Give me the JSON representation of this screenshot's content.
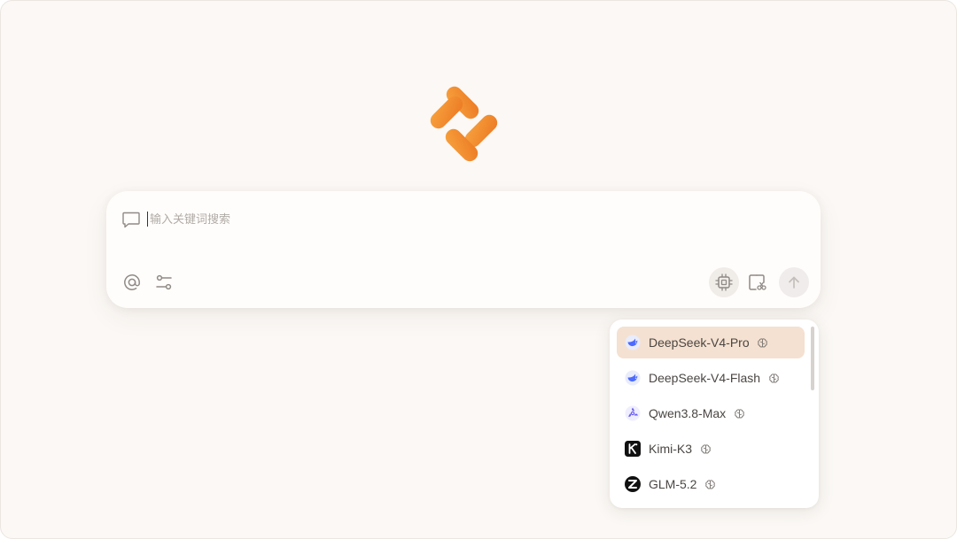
{
  "colors": {
    "background": "#fbf8f5",
    "brand_orange": "#f08a2a",
    "selected_item": "#f5e1d1",
    "text": "#4a4643",
    "placeholder": "#b0aba6"
  },
  "logo": {
    "icon": "orange-pill-logo"
  },
  "search": {
    "placeholder": "输入关键词搜索",
    "value": "",
    "leading_icon": "chat-bubble-icon"
  },
  "toolbar": {
    "left_icons": [
      "at-icon",
      "sliders-icon"
    ],
    "right_icons": [
      "chip-icon",
      "crop-icon",
      "arrow-up-icon"
    ]
  },
  "model_menu": {
    "selected": "DeepSeek-V4-Pro",
    "items": [
      {
        "label": "DeepSeek-V4-Pro",
        "icon": "deepseek-whale-icon",
        "reasoning_icon": "brain-icon"
      },
      {
        "label": "DeepSeek-V4-Flash",
        "icon": "deepseek-whale-icon",
        "reasoning_icon": "brain-icon"
      },
      {
        "label": "Qwen3.8-Max",
        "icon": "qwen-icon",
        "reasoning_icon": "brain-icon"
      },
      {
        "label": "Kimi-K3",
        "icon": "kimi-k-icon",
        "reasoning_icon": "brain-icon"
      },
      {
        "label": "GLM-5.2",
        "icon": "zhipu-z-icon",
        "reasoning_icon": "brain-icon"
      }
    ]
  }
}
